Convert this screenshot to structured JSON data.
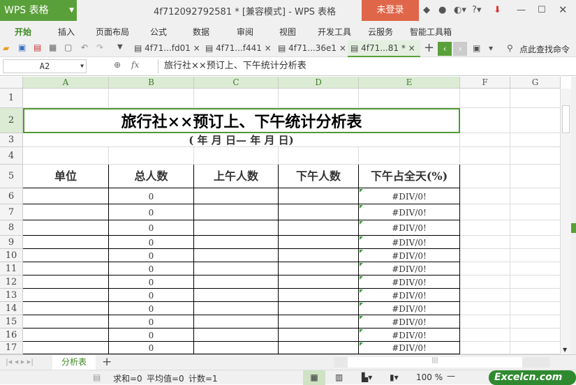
{
  "app": {
    "name": "WPS 表格",
    "doc_title": "4f712092792581 * [兼容模式] - WPS 表格",
    "login": "未登录"
  },
  "menu": [
    "开始",
    "插入",
    "页面布局",
    "公式",
    "数据",
    "审阅",
    "视图",
    "开发工具",
    "云服务",
    "智能工具箱"
  ],
  "tabs": [
    "4f71...fd01",
    "4f71...f441",
    "4f71...36e1",
    "4f71...81 *"
  ],
  "search_label": "点此查找命令",
  "formula_bar": {
    "cell_ref": "A2",
    "fx": "fx",
    "content": "旅行社××预订上、下午统计分析表"
  },
  "columns": [
    "A",
    "B",
    "C",
    "D",
    "E",
    "F",
    "G"
  ],
  "rows": [
    "1",
    "2",
    "3",
    "4",
    "5",
    "6",
    "7",
    "8",
    "9",
    "10",
    "11",
    "12",
    "13",
    "14",
    "15",
    "16",
    "17"
  ],
  "sheet": {
    "title": "旅行社××预订上、下午统计分析表",
    "date_line": "(  年 月  日— 年  月 日)",
    "headers": [
      "单位",
      "总人数",
      "上午人数",
      "下午人数",
      "下午占全天(%)"
    ],
    "total_values": [
      "0",
      "0",
      "0",
      "0",
      "0",
      "0",
      "0",
      "0",
      "0",
      "0",
      "0",
      "0"
    ],
    "ratio_values": [
      "#DIV/0!",
      "#DIV/0!",
      "#DIV/0!",
      "#DIV/0!",
      "#DIV/0!",
      "#DIV/0!",
      "#DIV/0!",
      "#DIV/0!",
      "#DIV/0!",
      "#DIV/0!",
      "#DIV/0!",
      "#DIV/0!"
    ]
  },
  "sheet_tabs": [
    "分析表"
  ],
  "status": {
    "sum": "求和=0",
    "avg": "平均值=0",
    "count": "计数=1",
    "zoom": "100 %"
  },
  "watermark": "Excelcn.com",
  "colors": {
    "accent": "#5aa03a",
    "login": "#e0664a"
  }
}
